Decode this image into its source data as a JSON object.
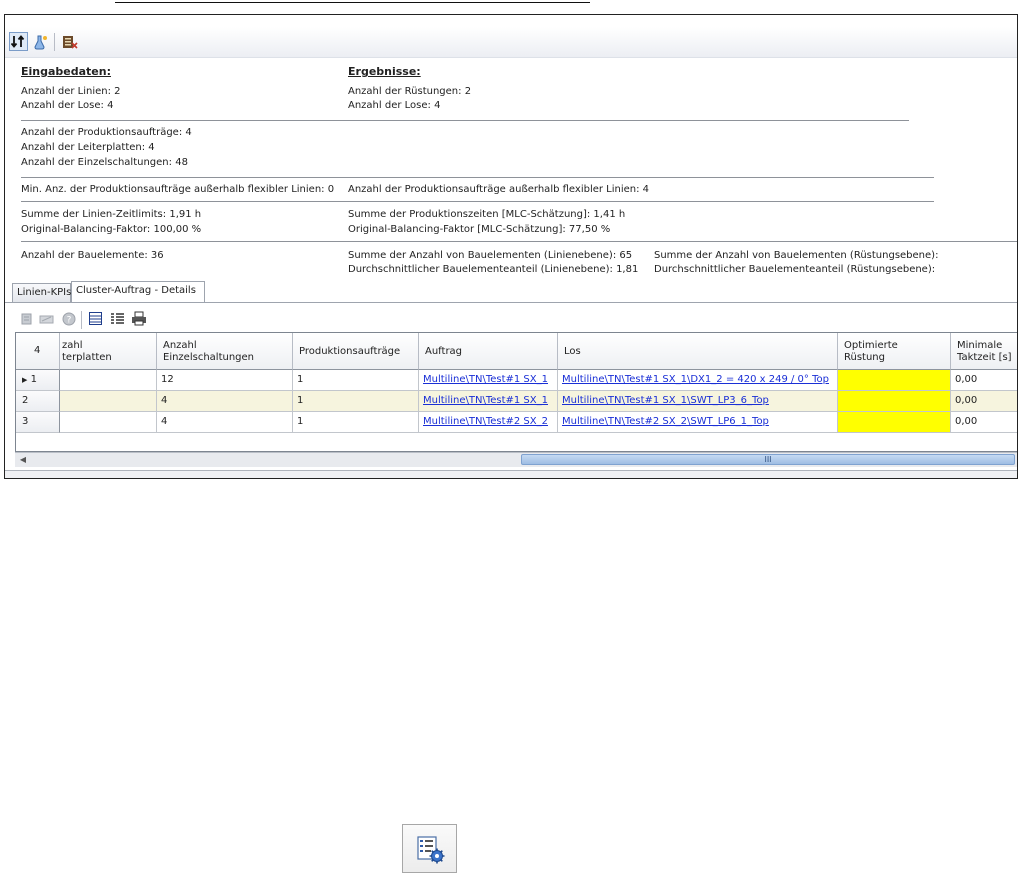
{
  "kpis": {
    "input_header": "Eingabedaten:",
    "results_header": "Ergebnisse:",
    "rows": [
      {
        "label": "Anzahl der Linien:",
        "value": "2"
      },
      {
        "label": "Anzahl der Lose:",
        "value": "4"
      },
      {
        "label": "Anzahl der Rüstungen:",
        "value": "2"
      },
      {
        "label": "Anzahl der Lose:",
        "value": "4"
      },
      {
        "label": "Anzahl der Produktionsaufträge:",
        "value": "4"
      },
      {
        "label": "Anzahl der Leiterplatten:",
        "value": "4"
      },
      {
        "label": "Anzahl der Einzelschaltungen:",
        "value": "48"
      },
      {
        "label": "Min. Anz. der Produktionsaufträge außerhalb flexibler Linien:",
        "value": "0"
      },
      {
        "label": "Anzahl der Produktionsaufträge außerhalb flexibler Linien:",
        "value": "4"
      },
      {
        "label": "Summe der Linien-Zeitlimits:",
        "value": "1,91 h"
      },
      {
        "label": "Original-Balancing-Faktor:",
        "value": "100,00 %"
      },
      {
        "label": "Summe der Produktionszeiten [MLC-Schätzung]:",
        "value": "1,41 h"
      },
      {
        "label": "Original-Balancing-Faktor [MLC-Schätzung]:",
        "value": "77,50 %"
      },
      {
        "label": "Anzahl der Bauelemente:",
        "value": "36"
      },
      {
        "label": "Summe der Anzahl von Bauelementen (Linienebene):",
        "value": "65"
      },
      {
        "label": "Durchschnittlicher Bauelementeanteil (Linienebene):",
        "value": "1,81"
      },
      {
        "label": "Summe der Anzahl von Bauelementen (Rüstungsebene):",
        "value": ""
      },
      {
        "label": "Durchschnittlicher Bauelementeanteil (Rüstungsebene):",
        "value": ""
      }
    ]
  },
  "tabs": [
    {
      "label": "Linien-KPIs"
    },
    {
      "label": "Cluster-Auftrag - Details"
    }
  ],
  "grid": {
    "row_count_header": "4",
    "columns": [
      {
        "label": "zahl\nterplatten"
      },
      {
        "label": "Anzahl\nEinzelschaltungen"
      },
      {
        "label": "Produktionsaufträge"
      },
      {
        "label": "Auftrag"
      },
      {
        "label": "Los"
      },
      {
        "label": "Optimierte\nRüstung"
      },
      {
        "label": "Minimale\nTaktzeit [s]"
      }
    ],
    "rows": [
      {
        "num": "1",
        "leiterplatten": "",
        "einzelschaltungen": "12",
        "produktionsauftraege": "1",
        "auftrag": "Multiline\\TN\\Test#1 SX_1",
        "los": "Multiline\\TN\\Test#1 SX_1\\DX1_2 = 420 x 249 / 0° Top",
        "optimierte_ruestung": "",
        "taktzeit": "0,00"
      },
      {
        "num": "2",
        "leiterplatten": "",
        "einzelschaltungen": "4",
        "produktionsauftraege": "1",
        "auftrag": "Multiline\\TN\\Test#1 SX_1",
        "los": "Multiline\\TN\\Test#1 SX_1\\SWT_LP3_6_Top",
        "optimierte_ruestung": "",
        "taktzeit": "0,00"
      },
      {
        "num": "3",
        "leiterplatten": "",
        "einzelschaltungen": "4",
        "produktionsauftraege": "1",
        "auftrag": "Multiline\\TN\\Test#2 SX_2",
        "los": "Multiline\\TN\\Test#2 SX_2\\SWT_LP6_1_Top",
        "optimierte_ruestung": "",
        "taktzeit": "0,00"
      }
    ],
    "scrollbar_grip": "III"
  },
  "colors": {
    "highlight_cell": "#ffff00",
    "link": "#1a2fd6",
    "alt_row": "#f6f4de"
  },
  "icons": [
    "sort-icon",
    "flask-icon",
    "report-icon",
    "move-icon",
    "edit-icon",
    "help-icon",
    "columns-icon",
    "grid-icon",
    "print-icon",
    "settings-list-icon"
  ]
}
